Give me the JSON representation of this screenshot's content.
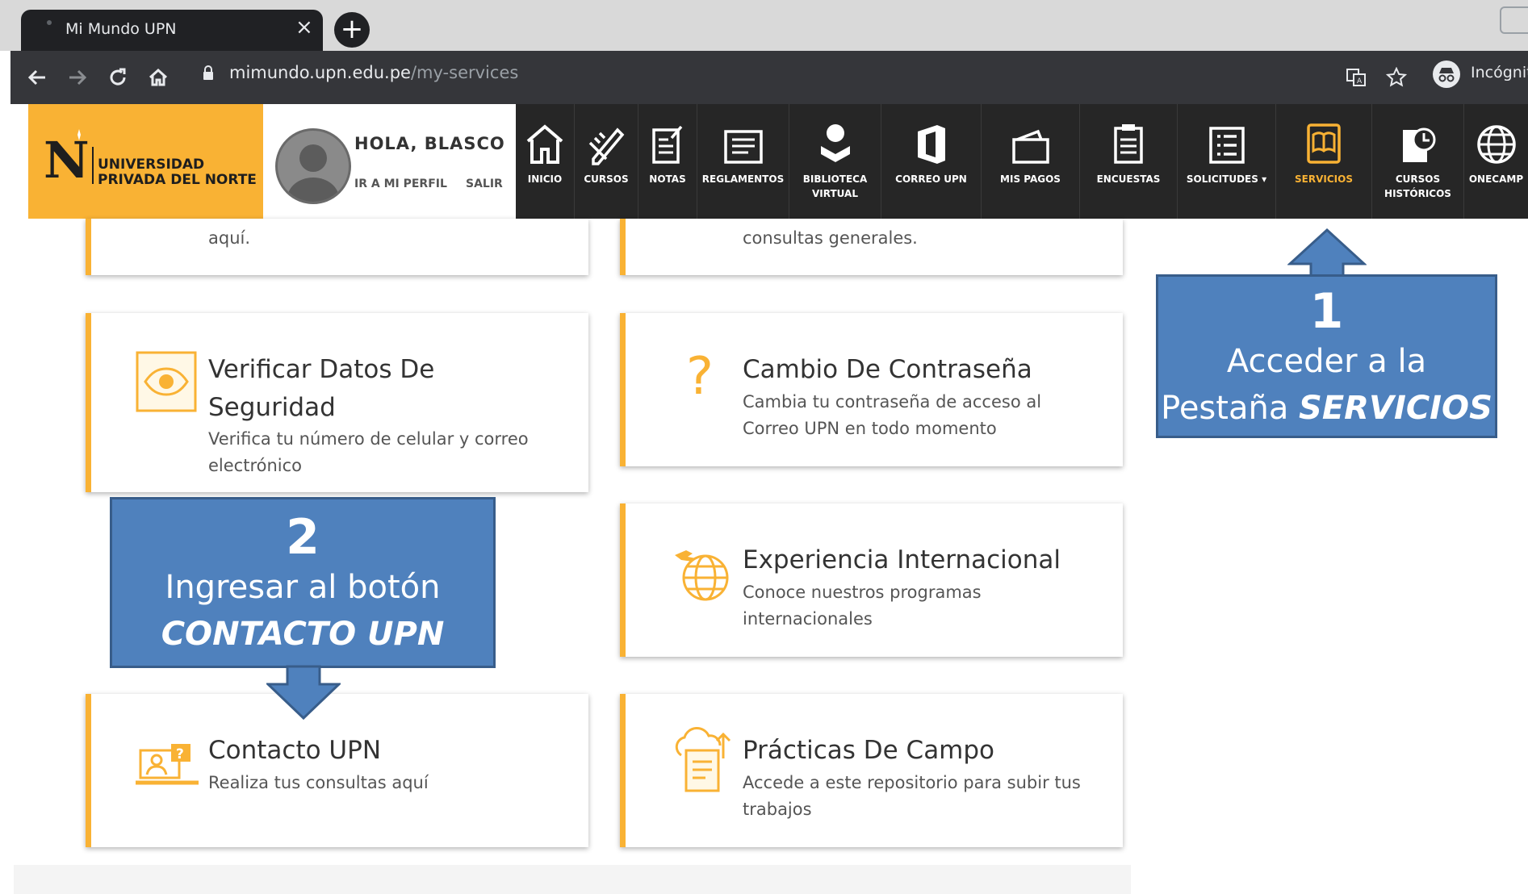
{
  "browser": {
    "tab_title": "Mi Mundo UPN",
    "tab_close": "×",
    "new_tab": "+",
    "url_host": "mimundo.upn.edu.pe",
    "url_path": "/my-services",
    "profile_label": "Incógnit"
  },
  "header": {
    "logo_mark": "N",
    "logo_line1": "UNIVERSIDAD",
    "logo_line2": "PRIVADA DEL NORTE",
    "greeting": "HOLA, BLASCO",
    "profile_link": "IR A MI PERFIL",
    "logout_link": "SALIR",
    "nav": [
      {
        "label": "INICIO",
        "icon": "home-icon"
      },
      {
        "label": "CURSOS",
        "icon": "pencil-ruler-icon"
      },
      {
        "label": "NOTAS",
        "icon": "notes-icon"
      },
      {
        "label": "REGLAMENTOS",
        "icon": "document-icon"
      },
      {
        "label": "BIBLIOTECA\nVIRTUAL",
        "icon": "library-user-icon"
      },
      {
        "label": "CORREO UPN",
        "icon": "office-icon"
      },
      {
        "label": "MIS PAGOS",
        "icon": "wallet-icon"
      },
      {
        "label": "ENCUESTAS",
        "icon": "clipboard-icon"
      },
      {
        "label": "SOLICITUDES",
        "icon": "list-icon",
        "dropdown": "▾"
      },
      {
        "label": "SERVICIOS",
        "icon": "services-book-icon",
        "active": true
      },
      {
        "label": "CURSOS\nHISTÓRICOS",
        "icon": "history-icon"
      },
      {
        "label": "ONECAMP",
        "icon": "globe-icon"
      }
    ],
    "accent_color": "#f9b234",
    "nav_bg": "#262626"
  },
  "cards": {
    "top_left_desc": "aquí.",
    "top_right_desc": "consultas generales.",
    "verificar": {
      "title_line1": "Verificar Datos De",
      "title_line2": "Seguridad",
      "desc_line1": "Verifica tu número de celular y correo",
      "desc_line2": "electrónico",
      "icon": "eye-icon"
    },
    "cambio": {
      "title": "Cambio De Contraseña",
      "desc_line1": "Cambia tu contraseña de acceso al",
      "desc_line2": "Correo UPN en todo momento",
      "icon": "question-icon",
      "icon_glyph": "?"
    },
    "experiencia": {
      "title": "Experiencia Internacional",
      "desc_line1": "Conoce nuestros programas",
      "desc_line2": "internacionales",
      "icon": "globe-plane-icon"
    },
    "contacto": {
      "title": "Contacto UPN",
      "desc_line1": "Realiza tus consultas aquí",
      "icon": "support-icon"
    },
    "practicas": {
      "title": "Prácticas De Campo",
      "desc_line1": "Accede a este repositorio para subir tus",
      "desc_line2": "trabajos",
      "icon": "cloud-docs-icon"
    }
  },
  "callouts": {
    "one": {
      "number": "1",
      "line1": "Acceder a la",
      "line2_prefix": "Pestaña ",
      "line2_emph": "SERVICIOS"
    },
    "two": {
      "number": "2",
      "line1": "Ingresar al botón",
      "line2_emph": "CONTACTO UPN"
    },
    "fill_color": "#4f81bd"
  }
}
